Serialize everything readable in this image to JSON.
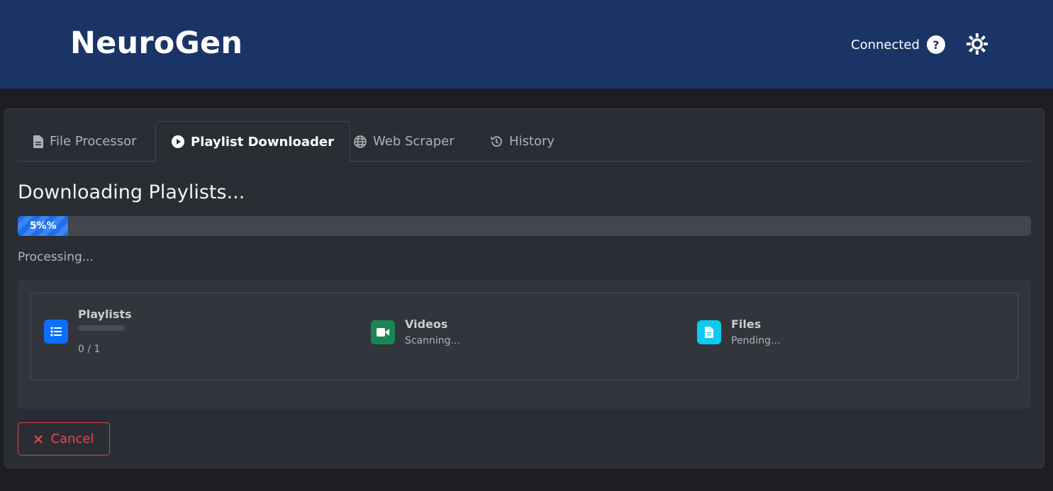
{
  "header": {
    "brand": "NeuroGen",
    "connection_status": "Connected",
    "help_glyph": "?"
  },
  "tabs": [
    {
      "label": "File Processor",
      "icon": "file-icon",
      "active": false
    },
    {
      "label": "Playlist Downloader",
      "icon": "play-circle-icon",
      "active": true
    },
    {
      "label": "Web Scraper",
      "icon": "globe-icon",
      "active": false
    },
    {
      "label": "History",
      "icon": "history-icon",
      "active": false
    }
  ],
  "main": {
    "title": "Downloading Playlists...",
    "progress": {
      "percent": 5,
      "label": "5%%"
    },
    "status_text": "Processing..."
  },
  "stats": {
    "playlists": {
      "label": "Playlists",
      "count": "0 / 1",
      "color": "#0d6efd"
    },
    "videos": {
      "label": "Videos",
      "status": "Scanning...",
      "color": "#198754"
    },
    "files": {
      "label": "Files",
      "status": "Pending...",
      "color": "#0dcaf0"
    }
  },
  "actions": {
    "cancel_label": "Cancel",
    "cancel_color": "#dc3545"
  }
}
